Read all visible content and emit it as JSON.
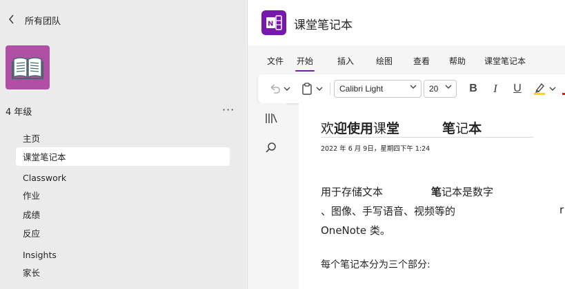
{
  "left_pane": {
    "back_label": "所有团队",
    "team_name": "4 年级",
    "more_label": "···",
    "nav_items": [
      {
        "label": "主页"
      },
      {
        "label": "课堂笔记本"
      },
      {
        "label": "Classwork"
      },
      {
        "label": "作业"
      },
      {
        "label": "成绩"
      },
      {
        "label": "反应"
      },
      {
        "label": "Insights"
      },
      {
        "label": "家长"
      }
    ]
  },
  "app": {
    "title": "课堂笔记本",
    "ribbon_tabs": [
      "文件",
      "开始",
      "插入",
      "绘图",
      "查看",
      "帮助",
      "课堂笔记本"
    ],
    "active_tab": "开始",
    "toolbar": {
      "font_name": "Calibri Light",
      "font_size": "20",
      "bold": "B",
      "italic": "I",
      "underline": "U"
    }
  },
  "page": {
    "title_part1": "欢",
    "title_part2": "迎使用",
    "title_part3": "课",
    "title_part4": "堂",
    "title_part5": "笔",
    "title_part6": "记",
    "title_part7": "本",
    "date": "2022 年 6 月 9日，星期四下午 1:24",
    "para1_line1_a": "用于存储文本",
    "para1_line1_b": "笔",
    "para1_line1_c": "记本是数字",
    "para1_line2": "、图像、手写语音、视频等的",
    "para1_line2_trail": "r",
    "para1_line3": "OneNote 类。",
    "para2": "每个笔记本分为三个部分:"
  },
  "colors": {
    "team_avatar": "#b050a4",
    "onenote_purple": "#7719aa",
    "highlight_yellow": "#ffd600"
  }
}
